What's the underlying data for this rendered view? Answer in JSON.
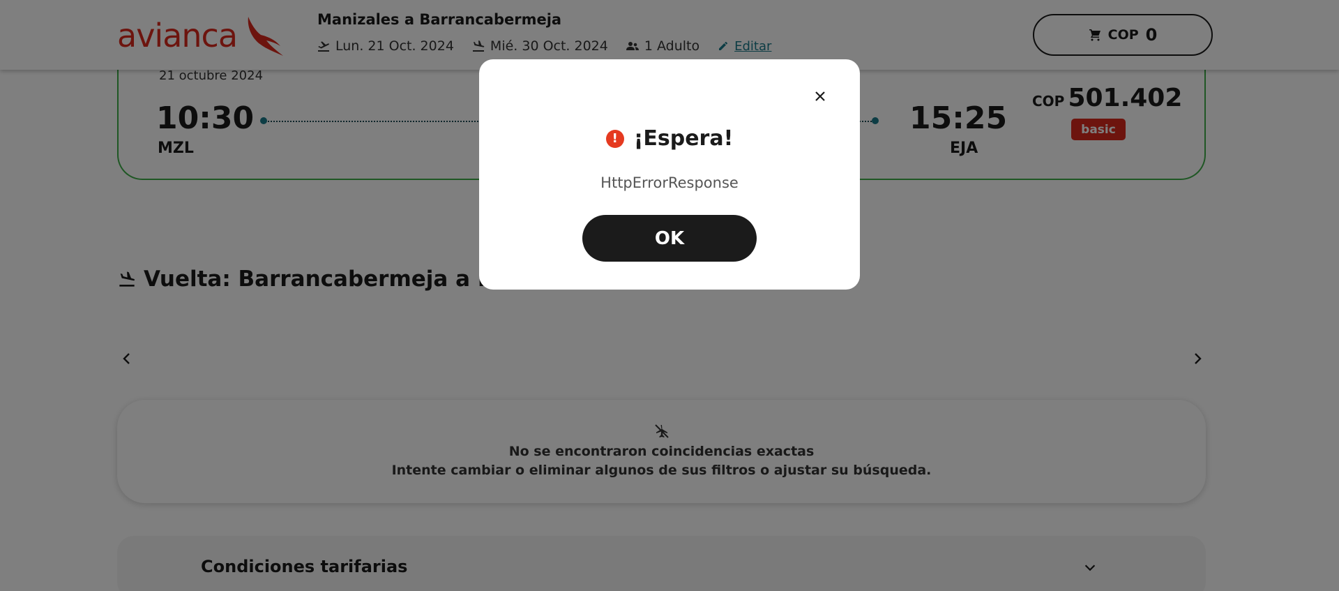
{
  "header": {
    "logo_text": "avianca",
    "trip_title": "Manizales a Barrancabermeja",
    "departure_date": "Lun. 21 Oct. 2024",
    "return_date": "Mié. 30 Oct. 2024",
    "passengers": "1 Adulto",
    "edit_label": "Editar",
    "cart_currency": "COP",
    "cart_amount": "0"
  },
  "flight": {
    "date": "21 octubre 2024",
    "departure_time": "10:30",
    "departure_code": "MZL",
    "arrival_time": "15:25",
    "arrival_code": "EJA",
    "price_currency": "COP",
    "price_value": "501.402",
    "fare_badge": "basic"
  },
  "return_section": {
    "title": "Vuelta: Barrancabermeja a Manizales"
  },
  "empty_state": {
    "line1": "No se encontraron coincidencias exactas",
    "line2": "Intente cambiar o eliminar algunos de sus filtros o ajustar su búsqueda."
  },
  "conditions": {
    "label": "Condiciones tarifarias"
  },
  "modal": {
    "title": "¡Espera!",
    "alert_symbol": "!",
    "message": "HttpErrorResponse",
    "ok_label": "OK"
  },
  "colors": {
    "brand_red": "#da291c",
    "accent_green": "#3fae49",
    "link_teal": "#1a7a8a",
    "alert_orange": "#e53a20",
    "dark": "#1b1b1b"
  },
  "icons": {
    "takeoff": "airplane-takeoff-icon",
    "landing": "airplane-landing-icon",
    "passengers": "people-icon",
    "edit": "pencil-icon",
    "cart": "shopping-cart-icon",
    "close": "close-icon",
    "alert": "alert-circle-icon",
    "no_flights": "airplane-off-icon",
    "prev": "chevron-left-icon",
    "next": "chevron-right-icon",
    "expand": "chevron-down-icon"
  }
}
